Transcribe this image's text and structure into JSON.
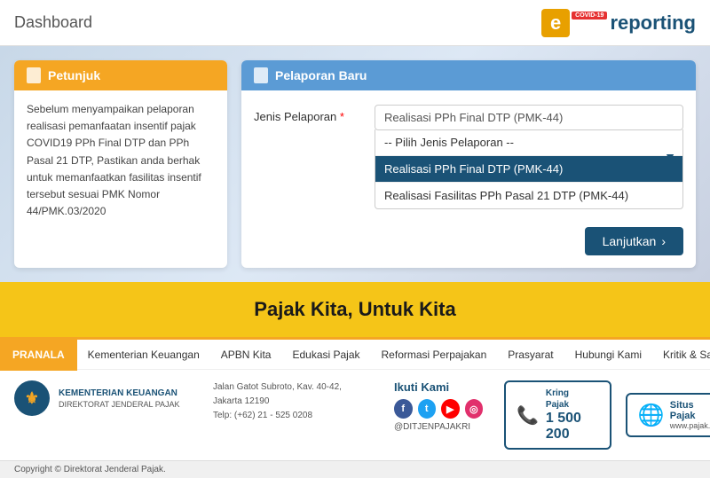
{
  "header": {
    "title": "Dashboard",
    "logo_e": "e",
    "logo_badge": "COVID-19",
    "logo_reporting": "reporting"
  },
  "petunjuk": {
    "header_label": "Petunjuk",
    "body_text": "Sebelum menyampaikan pelaporan realisasi pemanfaatan insentif pajak COVID19 PPh Final DTP dan PPh Pasal 21 DTP, Pastikan anda berhak untuk memanfaatkan fasilitas insentif tersebut sesuai PMK Nomor 44/PMK.03/2020"
  },
  "pelaporan": {
    "header_label": "Pelaporan Baru",
    "form_label": "Jenis Pelaporan",
    "select_placeholder": "-- Pilih Jenis Pelaporan --",
    "dropdown_options": [
      {
        "label": "-- Pilih Jenis Pelaporan --",
        "selected": false
      },
      {
        "label": "Realisasi PPh Final DTP (PMK-44)",
        "selected": true
      },
      {
        "label": "Realisasi Fasilitas PPh Pasal 21 DTP (PMK-44)",
        "selected": false
      }
    ],
    "btn_lanjutkan": "Lanjutkan"
  },
  "yellow_banner": {
    "text": "Pajak Kita, Untuk Kita"
  },
  "nav": {
    "pranala": "PRANALA",
    "items": [
      "Kementerian Keuangan",
      "APBN Kita",
      "Edukasi Pajak",
      "Reformasi Perpajakan",
      "Prasyarat",
      "Hubungi Kami",
      "Kritik & Saran"
    ]
  },
  "footer": {
    "ministry_name": "KEMENTERIAN KEUANGAN",
    "ministry_sub": "DIREKTORAT JENDERAL PAJAK",
    "address_line1": "Jalan Gatot Subroto, Kav. 40-42, Jakarta 12190",
    "address_line2": "Telp: (+62) 21 - 525 0208",
    "social_title": "Ikuti Kami",
    "social_handle": "@DITJENPAJAKRI",
    "kring_label": "Kring\nPajak",
    "kring_number": "1 500 200",
    "situs_label": "Situs\nPajak",
    "situs_url": "www.pajak.go.id",
    "copyright": "Copyright © Direktorat Jenderal Pajak."
  }
}
